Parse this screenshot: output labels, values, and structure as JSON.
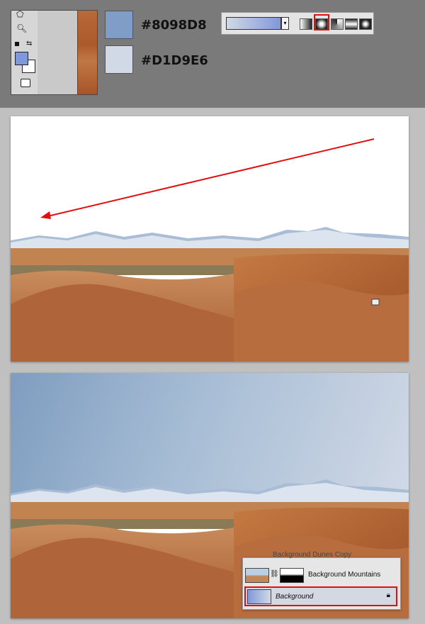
{
  "swatches": {
    "foreground": {
      "hex_label": "#8098D8",
      "color": "#8098d8"
    },
    "background": {
      "hex_label": "#D1D9E6",
      "color": "#d1d9e6"
    }
  },
  "colors": {
    "annotation_red": "#e30e0e",
    "sky_gradient_start": "#7f9dc0",
    "sky_gradient_end": "#d1d9e6"
  },
  "gradient_options": {
    "types": [
      "linear-gradient-icon",
      "radial-gradient-icon",
      "angle-gradient-icon",
      "reflected-gradient-icon",
      "diamond-gradient-icon"
    ],
    "selected": "radial-gradient-icon"
  },
  "layers_panel": {
    "partial_layer_name": "Background Dunes Copy",
    "layers": [
      {
        "name": "Background Mountains"
      },
      {
        "name": "Background",
        "selected": true,
        "locked": true
      }
    ]
  }
}
